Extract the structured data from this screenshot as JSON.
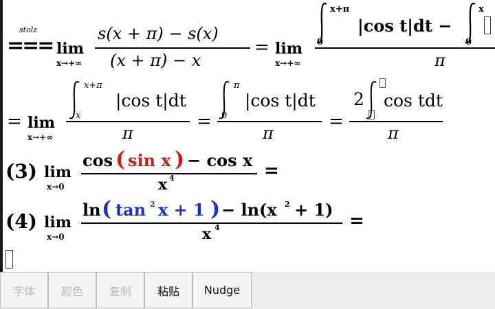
{
  "formula": {
    "line1": {
      "stolz": "stolz",
      "eq": "===",
      "lim": "lim",
      "sub": "x→+∞",
      "numerator": "s(x + π) − s(x)",
      "denominator": "(x + π) − x",
      "eq2": "=",
      "lim2": "lim",
      "sub2": "x→+∞",
      "upper1": "x+π",
      "lower1": "0",
      "integrand": "|cos t|dt −",
      "upper2": "x",
      "lower2": "0",
      "denominator2": "π"
    },
    "line2": {
      "eq": "=",
      "lim": "lim",
      "sub": "x→+∞",
      "upper": "x+π",
      "lower": "x",
      "integrand": "|cos t|dt",
      "den": "π",
      "eq2": "=",
      "upper2": "π",
      "lower2": "0",
      "integrand2": "|cos t|dt",
      "den2": "π",
      "eq3": "=",
      "coef": "2",
      "integrand3": "cos tdt",
      "den3": "π"
    },
    "problem3": {
      "label": "(3)",
      "lim": "lim",
      "sub": "x→0",
      "num_a": "cos",
      "num_paren_open": "(",
      "num_inner": "sin x",
      "num_paren_close": ")",
      "num_b": "− cos x",
      "den_base": "x",
      "den_exp": "4",
      "eq": "="
    },
    "problem4": {
      "label": "(4)",
      "lim": "lim",
      "sub": "x→0",
      "num_a": "ln",
      "num_paren_open": "(",
      "num_inner_a": "tan",
      "num_inner_exp": "2",
      "num_inner_b": "x + 1",
      "num_paren_close": ")",
      "num_b": "− ln(x",
      "num_b_exp": "2",
      "num_b_c": "+ 1)",
      "den_base": "x",
      "den_exp": "4",
      "eq": "="
    }
  },
  "toolbar": {
    "font": "字体",
    "color": "颜色",
    "copy": "复制",
    "paste": "粘贴",
    "nudge": "Nudge"
  },
  "colors": {
    "red": "#d41a1a",
    "blue": "#1d2fd4"
  }
}
